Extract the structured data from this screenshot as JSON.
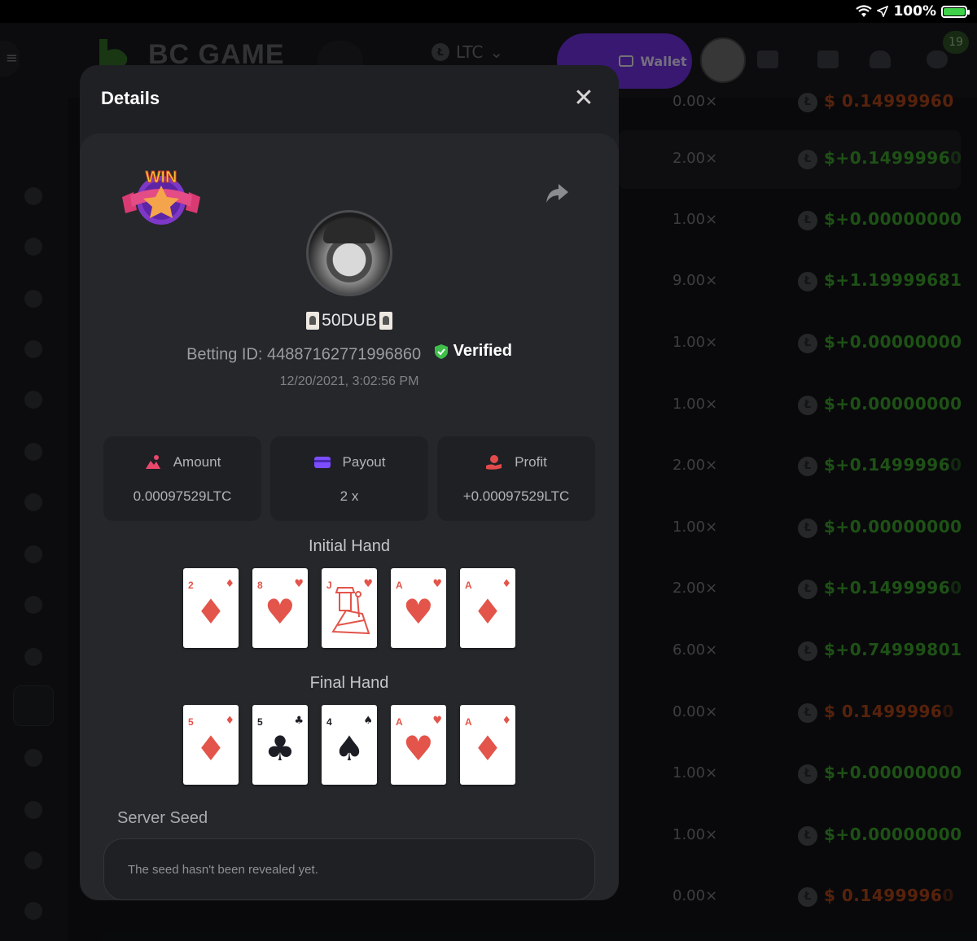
{
  "status_bar": {
    "battery": "100%"
  },
  "app": {
    "logo_text": "BC GAME",
    "currency": "LTC",
    "wallet_label": "Wallet",
    "notification_count": "19"
  },
  "rows": [
    {
      "mult": "0.00×",
      "payout": "0.14999960",
      "sign": "$ ",
      "type": "r"
    },
    {
      "mult": "2.00×",
      "payout": "0.1499996",
      "tail": "0",
      "sign": "$+",
      "type": "g"
    },
    {
      "mult": "1.00×",
      "payout": "0.00000000",
      "sign": "$+",
      "type": "g"
    },
    {
      "mult": "9.00×",
      "payout": "1.19999681",
      "sign": "$+",
      "type": "g"
    },
    {
      "mult": "1.00×",
      "payout": "0.00000000",
      "sign": "$+",
      "type": "g"
    },
    {
      "mult": "1.00×",
      "payout": "0.00000000",
      "sign": "$+",
      "type": "g"
    },
    {
      "mult": "2.00×",
      "payout": "0.1499996",
      "tail": "0",
      "sign": "$+",
      "type": "g"
    },
    {
      "mult": "1.00×",
      "payout": "0.00000000",
      "sign": "$+",
      "type": "g"
    },
    {
      "mult": "2.00×",
      "payout": "0.1499996",
      "tail": "0",
      "sign": "$+",
      "type": "g"
    },
    {
      "mult": "6.00×",
      "payout": "0.74999801",
      "sign": "$+",
      "type": "g"
    },
    {
      "mult": "0.00×",
      "payout": "0.1499996",
      "tail": "0",
      "sign": "$ ",
      "type": "r"
    },
    {
      "mult": "1.00×",
      "payout": "0.00000000",
      "sign": "$+",
      "type": "g"
    },
    {
      "mult": "1.00×",
      "payout": "0.00000000",
      "sign": "$+",
      "type": "g"
    },
    {
      "mult": "0.00×",
      "payout": "0.1499996",
      "tail": "0",
      "sign": "$ ",
      "type": "r"
    }
  ],
  "modal": {
    "title": "Details",
    "win_badge": "WIN",
    "player_name": "50DUB",
    "betting_label": "Betting ID: 448871627719968",
    "betting_id_end": "60",
    "verified_label": "Verified",
    "timestamp": "12/20/2021, 3:02:56 PM",
    "stats": [
      {
        "label": "Amount",
        "value": "0.00097529LTC",
        "icon": "bet-amount-icon",
        "color": "#e9476b"
      },
      {
        "label": "Payout",
        "value": "2 x",
        "icon": "payout-card-icon",
        "color": "#7c4dff"
      },
      {
        "label": "Profit",
        "value": "+0.00097529LTC",
        "icon": "profit-hand-icon",
        "color": "#e34b4b"
      }
    ],
    "initial_hand_title": "Initial Hand",
    "initial_hand": [
      {
        "rank": "2",
        "suit": "♦",
        "color": "red"
      },
      {
        "rank": "8",
        "suit": "♥",
        "color": "red"
      },
      {
        "rank": "J",
        "suit": "♥",
        "color": "red",
        "face": true
      },
      {
        "rank": "A",
        "suit": "♥",
        "color": "red"
      },
      {
        "rank": "A",
        "suit": "♦",
        "color": "red"
      }
    ],
    "final_hand_title": "Final Hand",
    "final_hand": [
      {
        "rank": "5",
        "suit": "♦",
        "color": "red"
      },
      {
        "rank": "5",
        "suit": "♣",
        "color": "blk"
      },
      {
        "rank": "4",
        "suit": "♠",
        "color": "blk"
      },
      {
        "rank": "A",
        "suit": "♥",
        "color": "red"
      },
      {
        "rank": "A",
        "suit": "♦",
        "color": "red"
      }
    ],
    "server_seed_label": "Server Seed",
    "server_seed_text": "The seed hasn't been revealed yet."
  }
}
